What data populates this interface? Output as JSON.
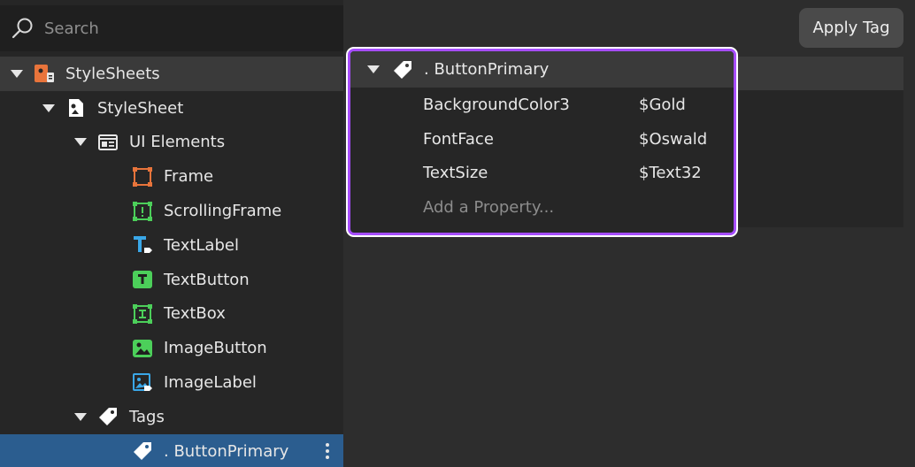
{
  "search": {
    "placeholder": "Search"
  },
  "apply_tag_label": "Apply Tag",
  "tree": [
    {
      "label": "StyleSheets",
      "icon": "stylesheets-icon"
    },
    {
      "label": "StyleSheet",
      "icon": "stylesheet-icon"
    },
    {
      "label": "UI Elements",
      "icon": "ui-elements-icon"
    },
    {
      "label": "Frame",
      "icon": "frame-icon"
    },
    {
      "label": "ScrollingFrame",
      "icon": "scrolling-frame-icon"
    },
    {
      "label": "TextLabel",
      "icon": "text-label-icon"
    },
    {
      "label": "TextButton",
      "icon": "text-button-icon"
    },
    {
      "label": "TextBox",
      "icon": "text-box-icon"
    },
    {
      "label": "ImageButton",
      "icon": "image-button-icon"
    },
    {
      "label": "ImageLabel",
      "icon": "image-label-icon"
    },
    {
      "label": "Tags",
      "icon": "tag-icon"
    },
    {
      "label": ". ButtonPrimary",
      "icon": "tag-icon"
    }
  ],
  "properties": {
    "title": ". ButtonPrimary",
    "rows": [
      {
        "key": "BackgroundColor3",
        "value": "$Gold"
      },
      {
        "key": "FontFace",
        "value": "$Oswald"
      },
      {
        "key": "TextSize",
        "value": "$Text32"
      }
    ],
    "add_label": "Add a Property..."
  },
  "colors": {
    "accent_highlight": "#a64dff",
    "selection": "#2b5d8f",
    "orange": "#e8743b",
    "green": "#4ccf5a",
    "blue": "#3aa7e8"
  }
}
